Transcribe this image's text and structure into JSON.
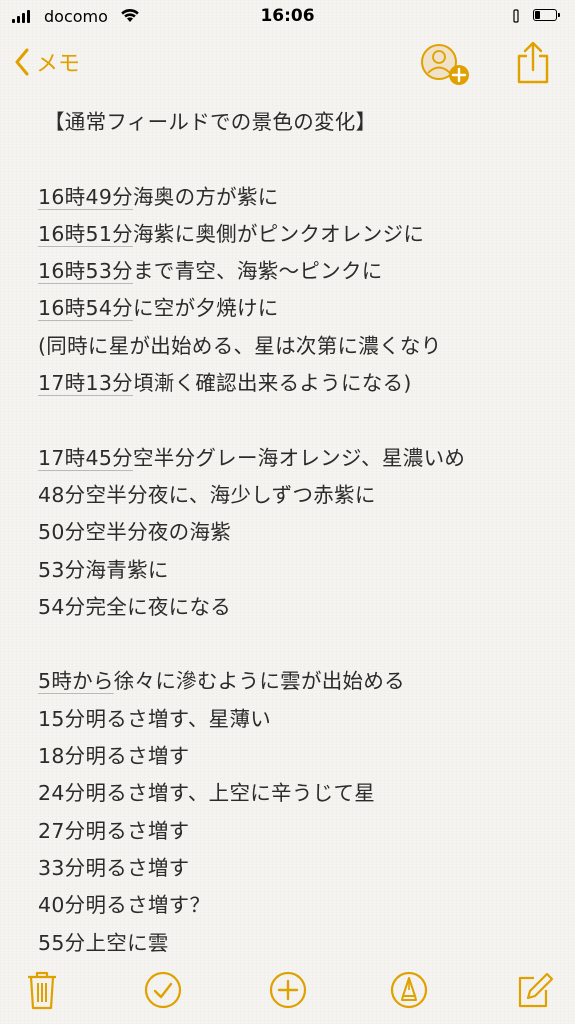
{
  "status_bar": {
    "carrier": "docomo",
    "time": "16:06",
    "battery_level": 0.3,
    "signal_bars": 4
  },
  "nav": {
    "back_label": "メモ",
    "accent": "#e0a100"
  },
  "note": {
    "title": "【通常フィールドでの景色の変化】",
    "block1": [
      {
        "time": "16時49分",
        "text": "海奥の方が紫に"
      },
      {
        "time": "16時51分",
        "text": "海紫に奥側がピンクオレンジに"
      },
      {
        "time": "16時53分",
        "text": "まで青空、海紫〜ピンクに"
      },
      {
        "time": "16時54分",
        "text": "に空が夕焼けに"
      },
      {
        "time": "",
        "text": "(同時に星が出始める、星は次第に濃くなり"
      },
      {
        "time": "17時13分",
        "text": "頃漸く確認出来るようになる)"
      }
    ],
    "block2": [
      {
        "time": "17時45分",
        "text": "空半分グレー海オレンジ、星濃いめ"
      },
      {
        "time": "",
        "text": "48分空半分夜に、海少しずつ赤紫に"
      },
      {
        "time": "",
        "text": "50分空半分夜の海紫"
      },
      {
        "time": "",
        "text": "53分海青紫に"
      },
      {
        "time": "",
        "text": "54分完全に夜になる"
      }
    ],
    "block3": [
      {
        "time": "5時から",
        "text": "徐々に滲むように雲が出始める"
      },
      {
        "time": "",
        "text": "15分明るさ増す、星薄い"
      },
      {
        "time": "",
        "text": "18分明るさ増す"
      },
      {
        "time": "",
        "text": "24分明るさ増す、上空に辛うじて星"
      },
      {
        "time": "",
        "text": "27分明るさ増す"
      },
      {
        "time": "",
        "text": "33分明るさ増す"
      },
      {
        "time": "",
        "text": "40分明るさ増す？"
      },
      {
        "time": "",
        "text": "55分上空に雲"
      }
    ]
  },
  "toolbar": {
    "icons": [
      "trash-icon",
      "checklist-icon",
      "add-icon",
      "markup-icon",
      "compose-icon"
    ]
  }
}
